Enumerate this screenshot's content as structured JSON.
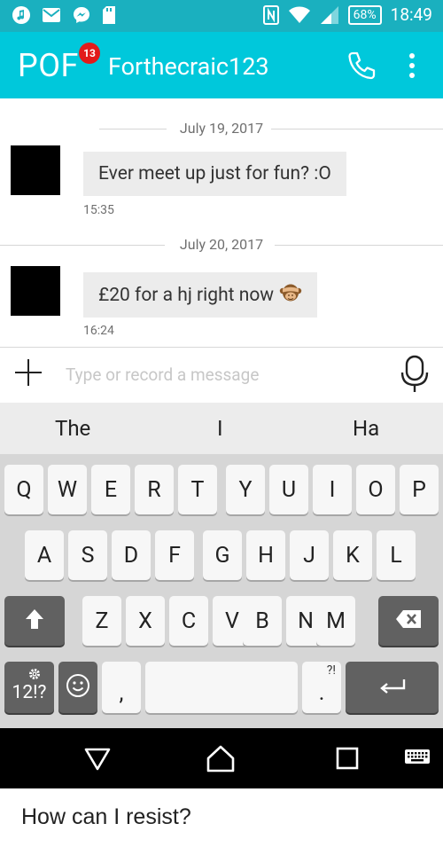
{
  "status_bar": {
    "battery": "68%",
    "time": "18:49",
    "icons": [
      "music-note-icon",
      "gmail-icon",
      "messenger-icon",
      "sd-card-icon",
      "nfc-icon",
      "wifi-icon",
      "signal-icon"
    ]
  },
  "app_bar": {
    "logo": "POF",
    "badge_count": "13",
    "username": "Forthecraic123",
    "bg_color": "#00c8db",
    "icons": [
      "phone-icon",
      "more-vert-icon"
    ]
  },
  "messages": [
    {
      "date": "July 19, 2017",
      "text": "Ever meet up just for fun? :O",
      "time": "15:35"
    },
    {
      "date": "July 20, 2017",
      "text": "£20 for a hj right now",
      "emoji": "see-no-evil-monkey-icon",
      "time": "16:24"
    }
  ],
  "composer": {
    "placeholder": "Type or record a message",
    "icons": [
      "plus-icon",
      "microphone-icon"
    ]
  },
  "keyboard": {
    "suggestions": [
      "The",
      "I",
      "Ha"
    ],
    "row1": [
      "Q",
      "W",
      "E",
      "R",
      "T",
      "Y",
      "U",
      "I",
      "O",
      "P"
    ],
    "row2": [
      "A",
      "S",
      "D",
      "F",
      "G",
      "H",
      "J",
      "K",
      "L"
    ],
    "row3": [
      "Z",
      "X",
      "C",
      "V",
      "B",
      "N",
      "M"
    ],
    "symbols_key": "12!?",
    "comma_key": ",",
    "period_key": ".",
    "period_sub": "?!",
    "icons": [
      "shift-icon",
      "backspace-icon",
      "settings-icon",
      "emoji-icon",
      "enter-icon"
    ]
  },
  "nav_bar": {
    "icons": [
      "back-icon",
      "home-icon",
      "recents-icon",
      "keyboard-icon"
    ]
  },
  "caption": "How can I resist?"
}
